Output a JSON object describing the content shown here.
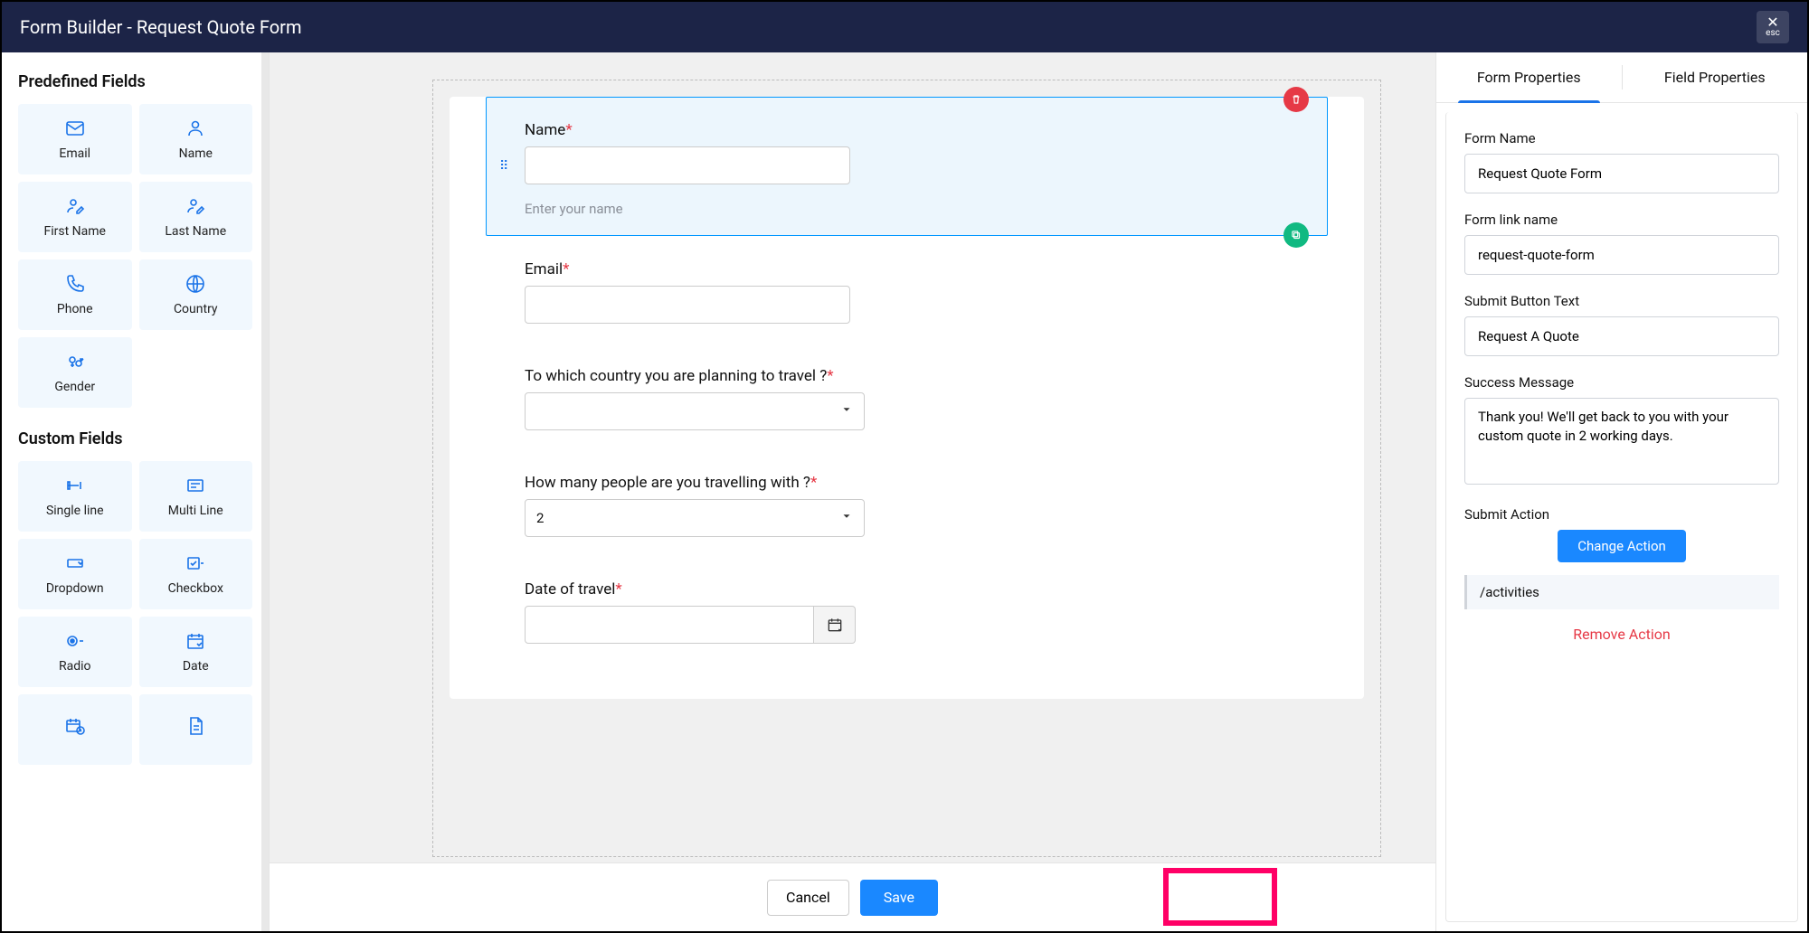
{
  "header": {
    "title": "Form Builder - Request Quote Form",
    "close": "esc"
  },
  "sidebar": {
    "predefined_title": "Predefined Fields",
    "custom_title": "Custom Fields",
    "predefined": [
      {
        "icon": "mail",
        "label": "Email"
      },
      {
        "icon": "user",
        "label": "Name"
      },
      {
        "icon": "user-edit",
        "label": "First Name"
      },
      {
        "icon": "user-edit",
        "label": "Last Name"
      },
      {
        "icon": "phone",
        "label": "Phone"
      },
      {
        "icon": "globe",
        "label": "Country"
      },
      {
        "icon": "gender",
        "label": "Gender"
      }
    ],
    "custom": [
      {
        "icon": "single",
        "label": "Single line"
      },
      {
        "icon": "multi",
        "label": "Multi Line"
      },
      {
        "icon": "dropdown",
        "label": "Dropdown"
      },
      {
        "icon": "checkbox",
        "label": "Checkbox"
      },
      {
        "icon": "radio",
        "label": "Radio"
      },
      {
        "icon": "date",
        "label": "Date"
      },
      {
        "icon": "datetime",
        "label": ""
      },
      {
        "icon": "file",
        "label": ""
      }
    ]
  },
  "form": {
    "fields": [
      {
        "label": "Name",
        "required": true,
        "type": "text",
        "helper": "Enter your name",
        "selected": true,
        "value": ""
      },
      {
        "label": "Email",
        "required": true,
        "type": "text",
        "helper": "",
        "selected": false,
        "value": ""
      },
      {
        "label": "To which country you are planning to travel ?",
        "required": true,
        "type": "select",
        "helper": "",
        "selected": false,
        "value": ""
      },
      {
        "label": "How many people are you travelling with ?",
        "required": true,
        "type": "select",
        "helper": "",
        "selected": false,
        "value": "2"
      },
      {
        "label": "Date of travel",
        "required": true,
        "type": "date",
        "helper": "",
        "selected": false,
        "value": ""
      }
    ]
  },
  "properties": {
    "tabs": {
      "form": "Form Properties",
      "field": "Field Properties"
    },
    "form_name_label": "Form Name",
    "form_name": "Request Quote Form",
    "link_name_label": "Form link name",
    "link_name": "request-quote-form",
    "submit_text_label": "Submit Button Text",
    "submit_text": "Request A Quote",
    "success_label": "Success Message",
    "success_message": "Thank you! We'll get back to you with your custom quote in 2 working days.",
    "submit_action_label": "Submit Action",
    "change_action": "Change Action",
    "action_path": "/activities",
    "remove_action": "Remove Action"
  },
  "footer": {
    "cancel": "Cancel",
    "save": "Save"
  }
}
